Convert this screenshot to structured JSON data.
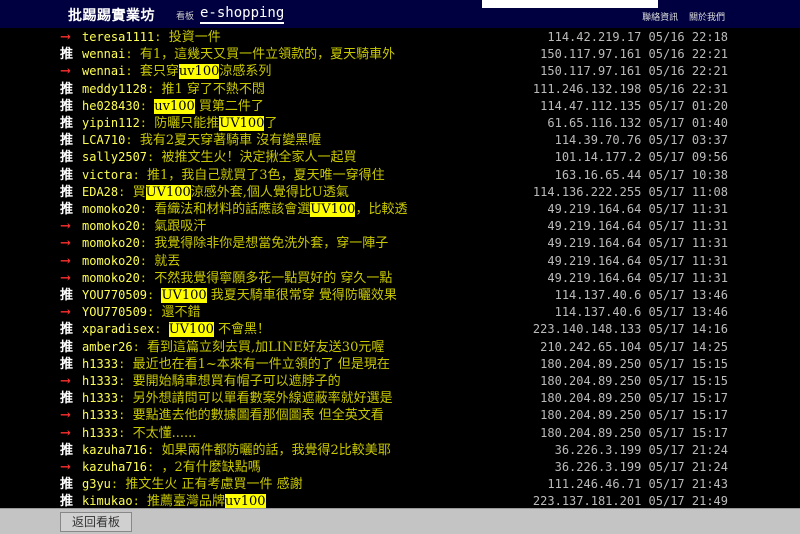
{
  "header": {
    "site_title": "批踢踢實業坊",
    "crumb_label": "看板",
    "board_name": "e-shopping",
    "nav": [
      "聯絡資訊",
      "關於我們"
    ]
  },
  "footer": {
    "back_label": "返回看板"
  },
  "comments": [
    {
      "tag": "→",
      "type": "arrow",
      "user": "teresa1111",
      "segments": [
        {
          "t": "投資一件"
        }
      ],
      "ip": "114.42.219.17",
      "date": "05/16 22:18"
    },
    {
      "tag": "推",
      "type": "push",
      "user": "wennai",
      "segments": [
        {
          "t": "有1，這幾天又買一件立領款的，夏天騎車外"
        }
      ],
      "ip": "150.117.97.161",
      "date": "05/16 22:21"
    },
    {
      "tag": "→",
      "type": "arrow",
      "user": "wennai",
      "segments": [
        {
          "t": "套只穿"
        },
        {
          "t": "uv100",
          "hl": true
        },
        {
          "t": "涼感系列"
        }
      ],
      "ip": "150.117.97.161",
      "date": "05/16 22:21"
    },
    {
      "tag": "推",
      "type": "push",
      "user": "meddy1128",
      "segments": [
        {
          "t": "推1 穿了不熱不悶"
        }
      ],
      "ip": "111.246.132.198",
      "date": "05/16 22:31"
    },
    {
      "tag": "推",
      "type": "push",
      "user": "he028430",
      "segments": [
        {
          "t": "uv100",
          "hl": true
        },
        {
          "t": " 買第二件了"
        }
      ],
      "ip": "114.47.112.135",
      "date": "05/17 01:20"
    },
    {
      "tag": "推",
      "type": "push",
      "user": "yipin112",
      "segments": [
        {
          "t": "防曬只能推"
        },
        {
          "t": "UV100",
          "hl": true
        },
        {
          "t": "了"
        }
      ],
      "ip": "61.65.116.132",
      "date": "05/17 01:40"
    },
    {
      "tag": "推",
      "type": "push",
      "user": "LCA710",
      "segments": [
        {
          "t": "我有2夏天穿著騎車 沒有變黑喔"
        }
      ],
      "ip": "114.39.70.76",
      "date": "05/17 03:37"
    },
    {
      "tag": "推",
      "type": "push",
      "user": "sally2507",
      "segments": [
        {
          "t": "被推文生火！決定揪全家人一起買"
        }
      ],
      "ip": "101.14.177.2",
      "date": "05/17 09:56"
    },
    {
      "tag": "推",
      "type": "push",
      "user": "victora",
      "segments": [
        {
          "t": "推1，我自己就買了3色，夏天唯一穿得住"
        }
      ],
      "ip": "163.16.65.44",
      "date": "05/17 10:38"
    },
    {
      "tag": "推",
      "type": "push",
      "user": "EDA28",
      "segments": [
        {
          "t": "買"
        },
        {
          "t": "UV100",
          "hl": true
        },
        {
          "t": "涼感外套,個人覺得比U透氣"
        }
      ],
      "ip": "114.136.222.255",
      "date": "05/17 11:08"
    },
    {
      "tag": "推",
      "type": "push",
      "user": "momoko20",
      "segments": [
        {
          "t": "看織法和材料的話應該會選"
        },
        {
          "t": "UV100",
          "hl": true
        },
        {
          "t": "，比較透"
        }
      ],
      "ip": "49.219.164.64",
      "date": "05/17 11:31"
    },
    {
      "tag": "→",
      "type": "arrow",
      "user": "momoko20",
      "segments": [
        {
          "t": "氣跟吸汗"
        }
      ],
      "ip": "49.219.164.64",
      "date": "05/17 11:31"
    },
    {
      "tag": "→",
      "type": "arrow",
      "user": "momoko20",
      "segments": [
        {
          "t": "我覺得除非你是想當免洗外套，穿一陣子"
        }
      ],
      "ip": "49.219.164.64",
      "date": "05/17 11:31"
    },
    {
      "tag": "→",
      "type": "arrow",
      "user": "momoko20",
      "segments": [
        {
          "t": "就丟"
        }
      ],
      "ip": "49.219.164.64",
      "date": "05/17 11:31"
    },
    {
      "tag": "→",
      "type": "arrow",
      "user": "momoko20",
      "segments": [
        {
          "t": "不然我覺得寧願多花一點買好的 穿久一點"
        }
      ],
      "ip": "49.219.164.64",
      "date": "05/17 11:31"
    },
    {
      "tag": "推",
      "type": "push",
      "user": "YOU770509",
      "segments": [
        {
          "t": "UV100",
          "hl": true
        },
        {
          "t": " 我夏天騎車很常穿 覺得防曬效果"
        }
      ],
      "ip": "114.137.40.6",
      "date": "05/17 13:46"
    },
    {
      "tag": "→",
      "type": "arrow",
      "user": "YOU770509",
      "segments": [
        {
          "t": "還不錯"
        }
      ],
      "ip": "114.137.40.6",
      "date": "05/17 13:46"
    },
    {
      "tag": "推",
      "type": "push",
      "user": "xparadisex",
      "segments": [
        {
          "t": "UV100",
          "hl": true
        },
        {
          "t": " 不會黑！"
        }
      ],
      "ip": "223.140.148.133",
      "date": "05/17 14:16"
    },
    {
      "tag": "推",
      "type": "push",
      "user": "amber26",
      "segments": [
        {
          "t": "看到這篇立刻去買,加LINE好友送30元喔"
        }
      ],
      "ip": "210.242.65.104",
      "date": "05/17 14:25"
    },
    {
      "tag": "推",
      "type": "push",
      "user": "h1333",
      "segments": [
        {
          "t": "最近也在看1~本來有一件立領的了 但是現在"
        }
      ],
      "ip": "180.204.89.250",
      "date": "05/17 15:15"
    },
    {
      "tag": "→",
      "type": "arrow",
      "user": "h1333",
      "segments": [
        {
          "t": "要開始騎車想買有帽子可以遮脖子的"
        }
      ],
      "ip": "180.204.89.250",
      "date": "05/17 15:15"
    },
    {
      "tag": "推",
      "type": "push",
      "user": "h1333",
      "segments": [
        {
          "t": "另外想請問可以單看數案外線遮蔽率就好選是"
        }
      ],
      "ip": "180.204.89.250",
      "date": "05/17 15:17"
    },
    {
      "tag": "→",
      "type": "arrow",
      "user": "h1333",
      "segments": [
        {
          "t": "要點進去他的數據圖看那個圖表 但全英文看"
        }
      ],
      "ip": "180.204.89.250",
      "date": "05/17 15:17"
    },
    {
      "tag": "→",
      "type": "arrow",
      "user": "h1333",
      "segments": [
        {
          "t": "不太懂......"
        }
      ],
      "ip": "180.204.89.250",
      "date": "05/17 15:17"
    },
    {
      "tag": "推",
      "type": "push",
      "user": "kazuha716",
      "segments": [
        {
          "t": "如果兩件都防曬的話，我覺得2比較美耶"
        }
      ],
      "ip": "36.226.3.199",
      "date": "05/17 21:24"
    },
    {
      "tag": "→",
      "type": "arrow",
      "user": "kazuha716",
      "segments": [
        {
          "t": "，2有什麼缺點嗎"
        }
      ],
      "ip": "36.226.3.199",
      "date": "05/17 21:24"
    },
    {
      "tag": "推",
      "type": "push",
      "user": "g3yu",
      "segments": [
        {
          "t": "推文生火 正有考慮買一件 感謝"
        }
      ],
      "ip": "111.246.46.71",
      "date": "05/17 21:43"
    },
    {
      "tag": "推",
      "type": "push",
      "user": "kimukao",
      "segments": [
        {
          "t": "推薦臺灣品牌"
        },
        {
          "t": "uv100",
          "hl": true
        }
      ],
      "ip": "223.137.181.201",
      "date": "05/17 21:49"
    }
  ]
}
